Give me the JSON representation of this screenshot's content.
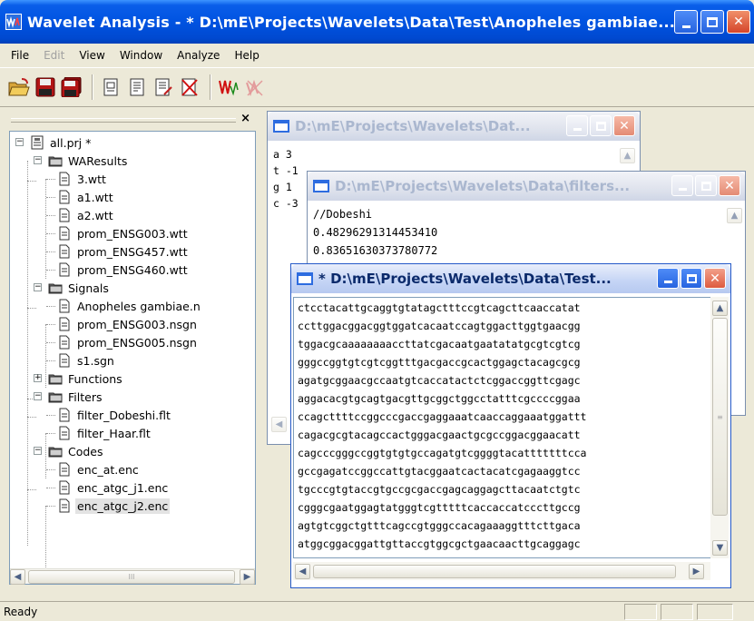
{
  "window": {
    "title": "Wavelet Analysis - * D:\\mE\\Projects\\Wavelets\\Data\\Test\\Anopheles gambiae...."
  },
  "menu": [
    "File",
    "Edit",
    "View",
    "Window",
    "Analyze",
    "Help"
  ],
  "menu_disabled": [
    "Edit"
  ],
  "toolbar": {
    "icons": [
      "open-folder-icon",
      "save-icon",
      "save-all-icon",
      "new-project-icon",
      "properties-icon",
      "edit-document-icon",
      "delete-document-icon",
      "wavelet-transform-icon",
      "clear-transform-icon"
    ]
  },
  "tree": {
    "root": "all.prj *",
    "groups": [
      {
        "name": "WAResults",
        "expanded": true,
        "items": [
          "3.wtt",
          "a1.wtt",
          "a2.wtt",
          "prom_ENSG003.wtt",
          "prom_ENSG457.wtt",
          "prom_ENSG460.wtt"
        ]
      },
      {
        "name": "Signals",
        "expanded": true,
        "items": [
          "Anopheles gambiae.n",
          "prom_ENSG003.nsgn",
          "prom_ENSG005.nsgn",
          "s1.sgn"
        ]
      },
      {
        "name": "Functions",
        "expanded": false,
        "items": []
      },
      {
        "name": "Filters",
        "expanded": true,
        "items": [
          "filter_Dobeshi.flt",
          "filter_Haar.flt"
        ]
      },
      {
        "name": "Codes",
        "expanded": true,
        "items": [
          "enc_at.enc",
          "enc_atgc_j1.enc",
          "enc_atgc_j2.enc"
        ]
      }
    ],
    "selected": "enc_atgc_j2.enc",
    "hscroll_thumb_glyph": "III"
  },
  "child1": {
    "title": "D:\\mE\\Projects\\Wavelets\\Dat...",
    "lines": [
      "a 3",
      "t -1",
      "g 1",
      "c -3"
    ]
  },
  "child2": {
    "title": "D:\\mE\\Projects\\Wavelets\\Data\\filters...",
    "lines": [
      "//Dobeshi",
      "0.48296291314453410",
      "0.83651630373780772"
    ]
  },
  "child3": {
    "title": "* D:\\mE\\Projects\\Wavelets\\Data\\Test...",
    "lines": [
      "ctcctacattgcaggtgtatagctttccgtcagcttcaaccatat",
      "ccttggacggacggtggatcacaatccagtggacttggtgaacgg",
      "tggacgcaaaaaaaaccttatcgacaatgaatatatgcgtcgtcg",
      "gggccggtgtcgtcggtttgacgaccgcactggagctacagcgcg",
      "agatgcggaacgccaatgtcaccatactctcggaccggttcgagc",
      "aggacacgtgcagtgacgttgcggctggcctatttcgccccggaa",
      "ccagcttttccggcccgaccgaggaaatcaaccaggaaatggattt",
      "cagacgcgtacagccactgggacgaactgcgccggacggaacatt",
      "cagcccgggccggtgtgtgccagatgtcggggtacatttttttcca",
      "gccgagatccggccattgtacggaatcactacatcgagaaggtcc",
      "tgcccgtgtaccgtgccgcgaccgagcaggagcttacaatctgtc",
      "cgggcgaatggagtatgggtcgtttttcaccaccatcccttgccg",
      "agtgtcggctgtttcagccgtgggccacagaaaggtttcttgaca",
      "atggcggacggattgttaccgtggcgctgaacaacttgcaggagc"
    ]
  },
  "status": {
    "text": "Ready"
  }
}
